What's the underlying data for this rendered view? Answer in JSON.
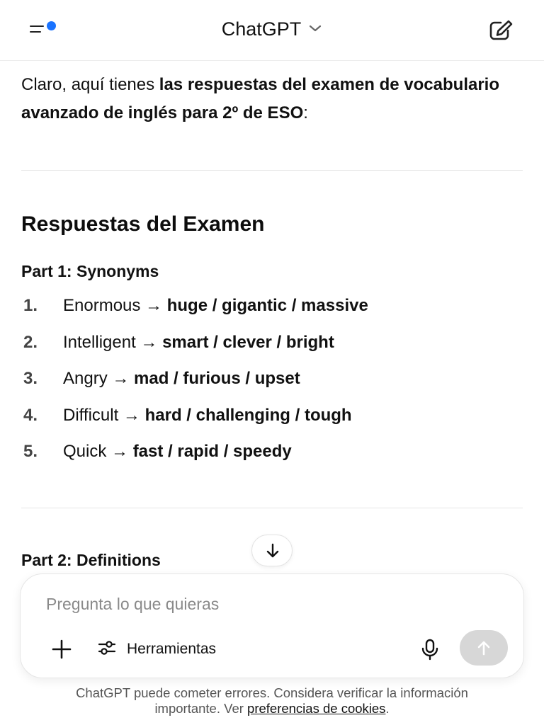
{
  "header": {
    "title": "ChatGPT",
    "menu_icon": "sidebar-menu-icon",
    "dropdown_icon": "chevron-down-icon",
    "new_chat_icon": "compose-icon",
    "notification_color": "#1a73ff"
  },
  "message": {
    "intro_plain": "Claro, aquí tienes ",
    "intro_bold": "las respuestas del examen de vocabulario avanzado de inglés para 2º de ESO",
    "intro_end": ":",
    "heading": "Respuestas del Examen",
    "part1_title": "Part 1: Synonyms",
    "synonyms": [
      {
        "num": "1.",
        "word": "Enormous → ",
        "answer": "huge / gigantic / massive"
      },
      {
        "num": "2.",
        "word": "Intelligent → ",
        "answer": "smart / clever / bright"
      },
      {
        "num": "3.",
        "word": "Angry → ",
        "answer": "mad / furious / upset"
      },
      {
        "num": "4.",
        "word": "Difficult → ",
        "answer": "hard / challenging / tough"
      },
      {
        "num": "5.",
        "word": "Quick → ",
        "answer": "fast / rapid / speedy"
      }
    ],
    "part2_title": "Part 2: Definitions"
  },
  "composer": {
    "placeholder": "Pregunta lo que quieras",
    "value": "",
    "tools_label": "Herramientas",
    "send_color": "#d7d7d7"
  },
  "footer": {
    "line1": "ChatGPT puede cometer errores. Considera verificar la información",
    "line2_prefix": "importante. Ver ",
    "link": "preferencias de cookies",
    "line2_suffix": "."
  }
}
